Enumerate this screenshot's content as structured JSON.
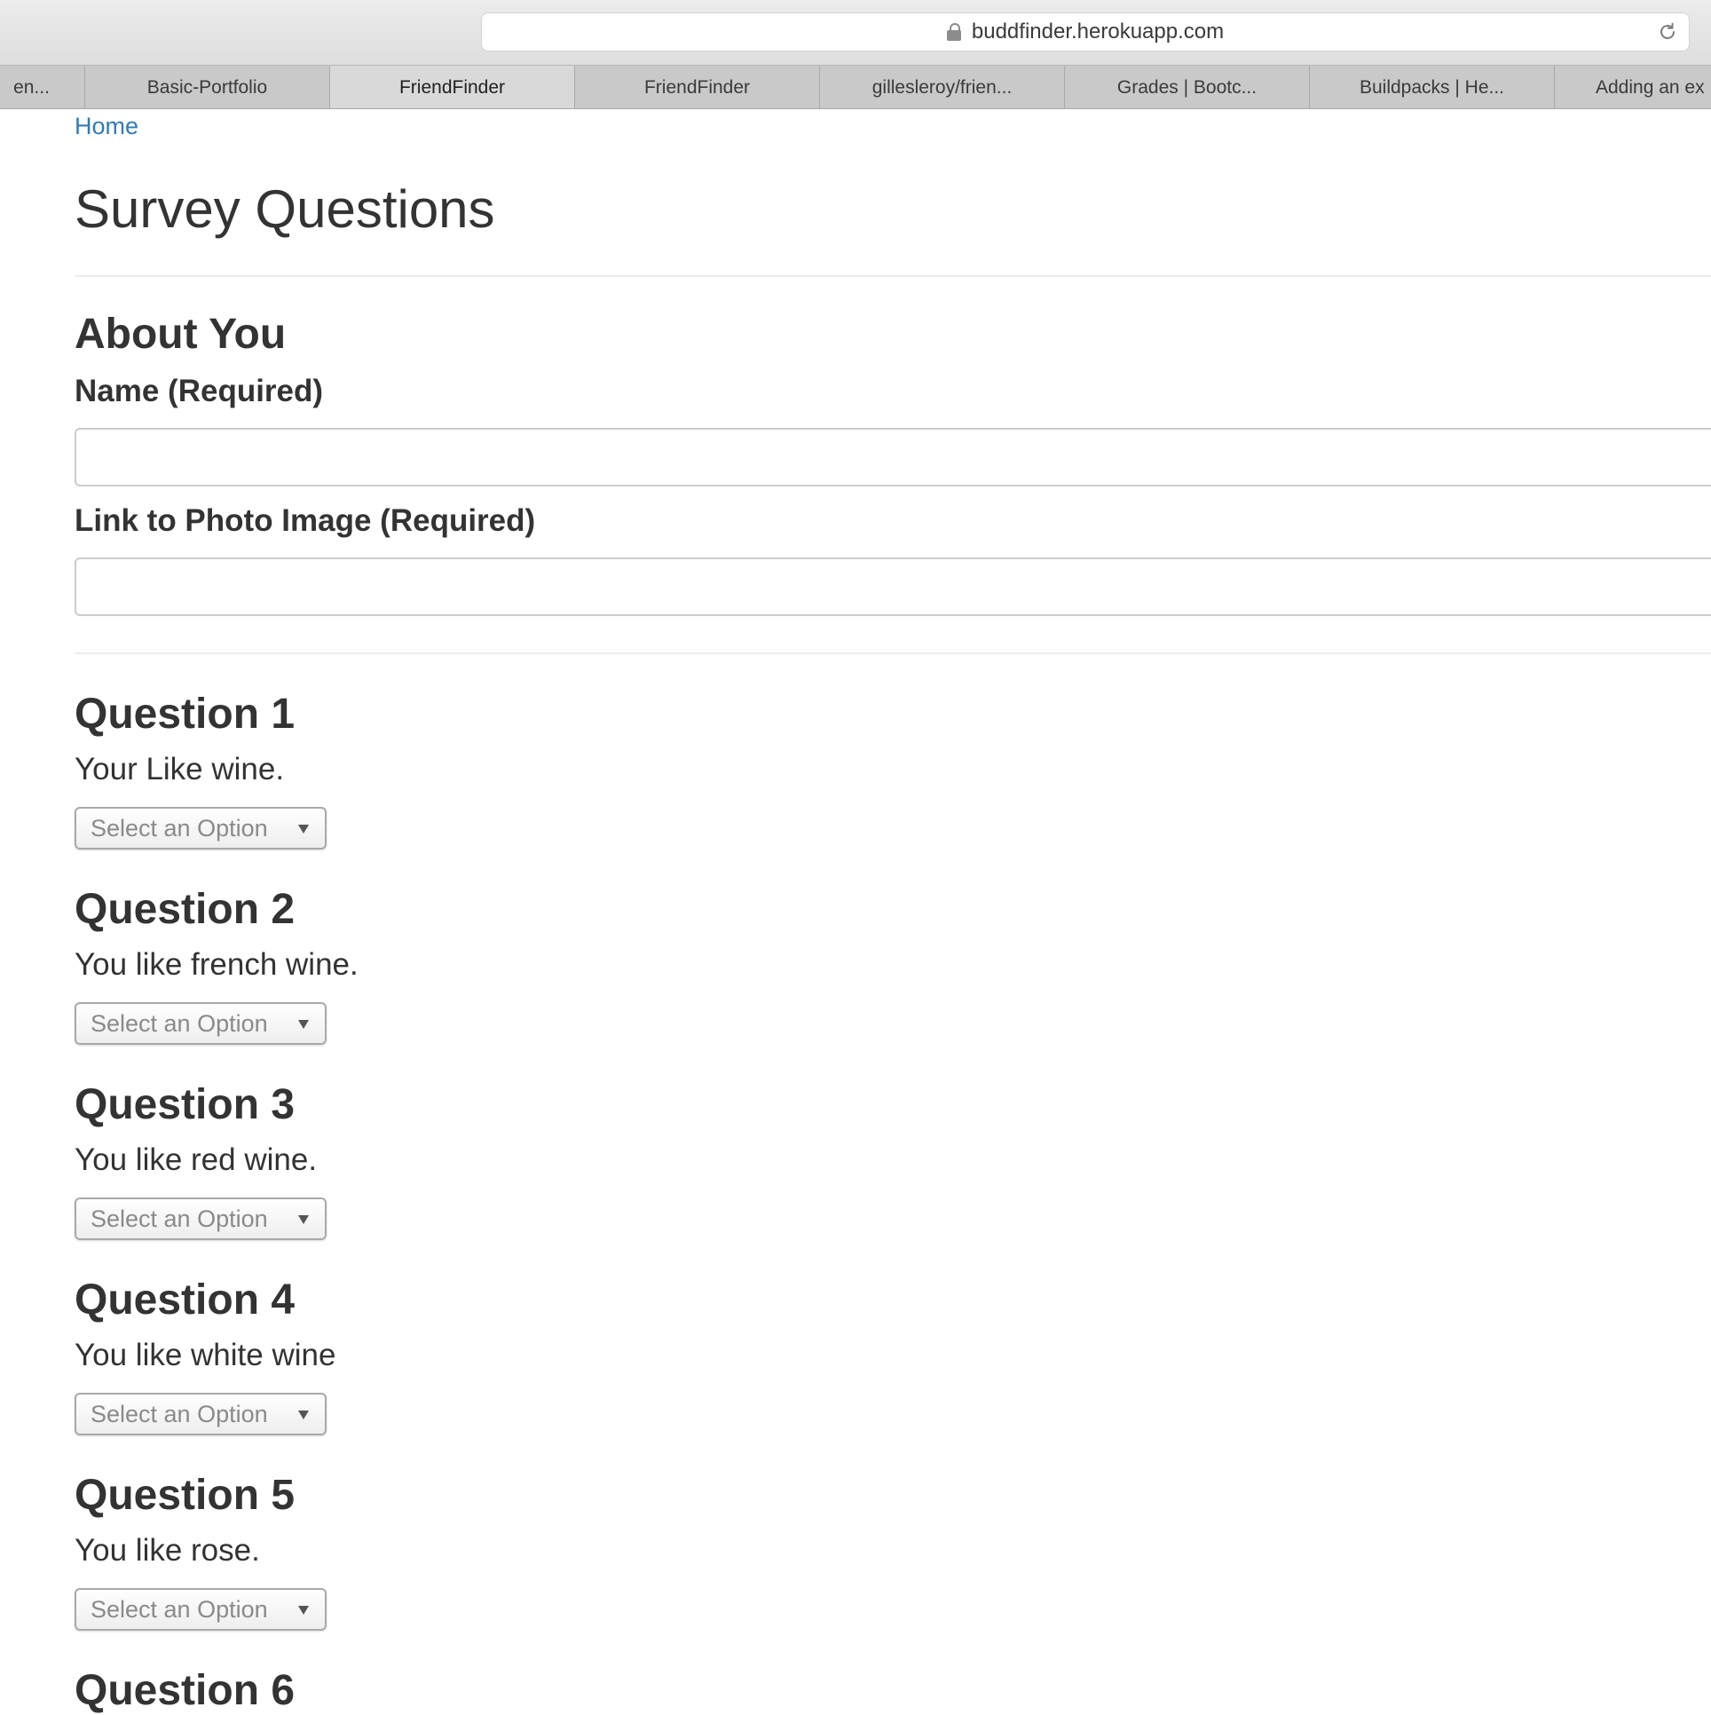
{
  "browser": {
    "url": "buddfinder.herokuapp.com",
    "tabs": [
      {
        "label": "en..."
      },
      {
        "label": "Basic-Portfolio"
      },
      {
        "label": "FriendFinder"
      },
      {
        "label": "FriendFinder"
      },
      {
        "label": "gillesleroy/frien..."
      },
      {
        "label": "Grades | Bootc..."
      },
      {
        "label": "Buildpacks | He..."
      },
      {
        "label": "Adding an ex"
      }
    ]
  },
  "page": {
    "home_link": "Home",
    "title": "Survey Questions",
    "about": {
      "heading": "About You",
      "name_label": "Name (Required)",
      "name_value": "",
      "photo_label": "Link to Photo Image (Required)",
      "photo_value": ""
    },
    "select_placeholder": "Select an Option",
    "questions": [
      {
        "heading": "Question 1",
        "text": "Your Like wine."
      },
      {
        "heading": "Question 2",
        "text": "You like french wine."
      },
      {
        "heading": "Question 3",
        "text": "You like red wine."
      },
      {
        "heading": "Question 4",
        "text": "You like white wine"
      },
      {
        "heading": "Question 5",
        "text": "You like rose."
      },
      {
        "heading": "Question 6",
        "text": ""
      }
    ]
  },
  "colors": {
    "link": "#337ab7",
    "text": "#333333"
  }
}
